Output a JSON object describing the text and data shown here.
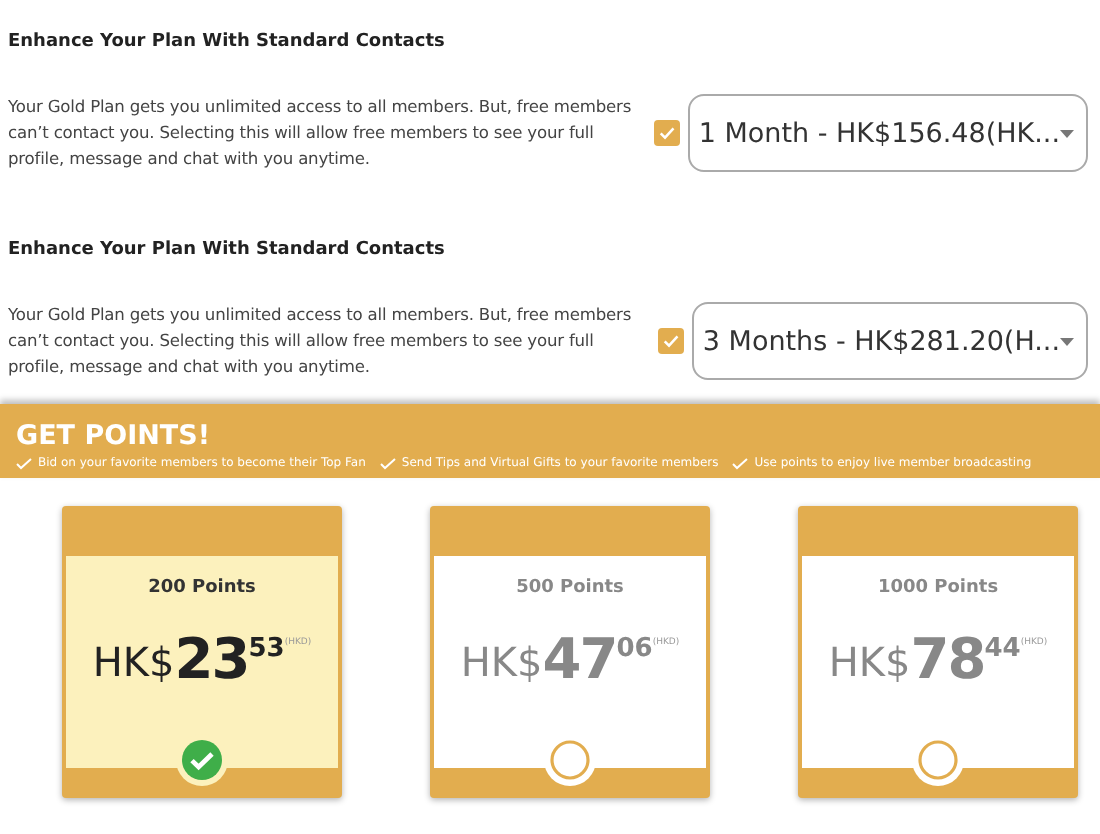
{
  "addons": [
    {
      "title": "Enhance Your Plan With Standard Contacts",
      "description": "Your Gold Plan gets you unlimited access to all members. But, free members can’t contact you. Selecting this will allow free members to see your full profile, message and chat with you anytime.",
      "checked": true,
      "select_value": "1 Month - HK$156.48(HK..."
    },
    {
      "title": "Enhance Your Plan With Standard Contacts",
      "description": "Your Gold Plan gets you unlimited access to all members. But, free members can’t contact you. Selecting this will allow free members to see your full profile, message and chat with you anytime.",
      "checked": true,
      "select_value": "3 Months - HK$281.20(H..."
    }
  ],
  "points_banner": {
    "title": "GET POINTS!",
    "benefits": [
      "Bid on your favorite members to become their Top Fan",
      "Send Tips and Virtual Gifts to your favorite members",
      "Use points to enjoy live member broadcasting"
    ]
  },
  "packages": [
    {
      "name": "200 Points",
      "currency": "HK$",
      "whole": "23",
      "cents": "53",
      "unit": "(HKD)",
      "selected": true
    },
    {
      "name": "500 Points",
      "currency": "HK$",
      "whole": "47",
      "cents": "06",
      "unit": "(HKD)",
      "selected": false
    },
    {
      "name": "1000 Points",
      "currency": "HK$",
      "whole": "78",
      "cents": "44",
      "unit": "(HKD)",
      "selected": false
    }
  ]
}
